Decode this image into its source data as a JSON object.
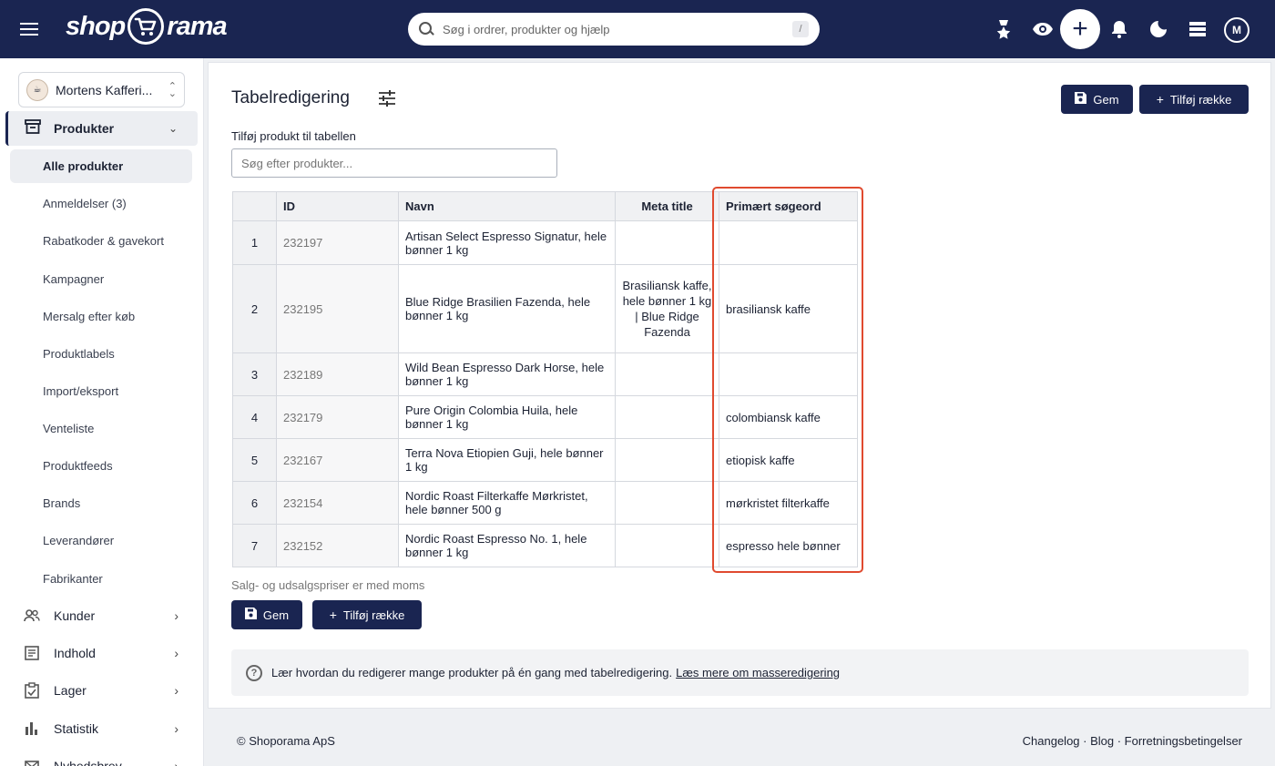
{
  "topbar": {
    "logo_left": "shop",
    "logo_right": "rama",
    "search_placeholder": "Søg i ordrer, produkter og hjælp",
    "search_shortcut": "/",
    "avatar_initial": "M"
  },
  "sidebar": {
    "shop_name": "Mortens Kafferi...",
    "active_section": "Produkter",
    "sub_items": [
      "Alle produkter",
      "Anmeldelser (3)",
      "Rabatkoder & gavekort",
      "Kampagner",
      "Mersalg efter køb",
      "Produktlabels",
      "Import/eksport",
      "Venteliste",
      "Produktfeeds",
      "Brands",
      "Leverandører",
      "Fabrikanter"
    ],
    "selected_sub": "Alle produkter",
    "sections": [
      "Kunder",
      "Indhold",
      "Lager",
      "Statistik",
      "Nyhedsbrev"
    ]
  },
  "main": {
    "title": "Tabelredigering",
    "save_label": "Gem",
    "add_row_label": "Tilføj række",
    "add_product_label": "Tilføj produkt til tabellen",
    "add_product_placeholder": "Søg efter produkter...",
    "note": "Salg- og udsalgspriser er med moms",
    "info_text": "Lær hvordan du redigerer mange produkter på én gang med tabelredigering.",
    "info_link": "Læs mere om masseredigering"
  },
  "table": {
    "headers": [
      "",
      "ID",
      "Navn",
      "Meta title",
      "Primært søgeord"
    ],
    "rows": [
      {
        "num": "1",
        "id": "232197",
        "name": "Artisan Select Espresso Signatur, hele bønner 1 kg",
        "meta": "",
        "keyword": ""
      },
      {
        "num": "2",
        "id": "232195",
        "name": "Blue Ridge Brasilien Fazenda, hele bønner 1 kg",
        "meta": "Brasiliansk kaffe, hele bønner 1 kg | Blue Ridge Fazenda",
        "keyword": "brasiliansk kaffe"
      },
      {
        "num": "3",
        "id": "232189",
        "name": "Wild Bean Espresso Dark Horse, hele bønner 1 kg",
        "meta": "",
        "keyword": ""
      },
      {
        "num": "4",
        "id": "232179",
        "name": "Pure Origin Colombia Huila, hele bønner 1 kg",
        "meta": "",
        "keyword": "colombiansk kaffe"
      },
      {
        "num": "5",
        "id": "232167",
        "name": "Terra Nova Etiopien Guji, hele bønner 1 kg",
        "meta": "",
        "keyword": "etiopisk kaffe"
      },
      {
        "num": "6",
        "id": "232154",
        "name": "Nordic Roast Filterkaffe Mørkristet, hele bønner 500 g",
        "meta": "",
        "keyword": "mørkristet filterkaffe"
      },
      {
        "num": "7",
        "id": "232152",
        "name": "Nordic Roast Espresso No. 1, hele bønner 1 kg",
        "meta": "",
        "keyword": "espresso hele bønner"
      }
    ]
  },
  "footer": {
    "copyright": "© Shoporama ApS",
    "links": "Changelog · Blog · Forretningsbetingelser"
  },
  "colors": {
    "navy": "#1a2551",
    "highlight": "#e04a2f"
  }
}
